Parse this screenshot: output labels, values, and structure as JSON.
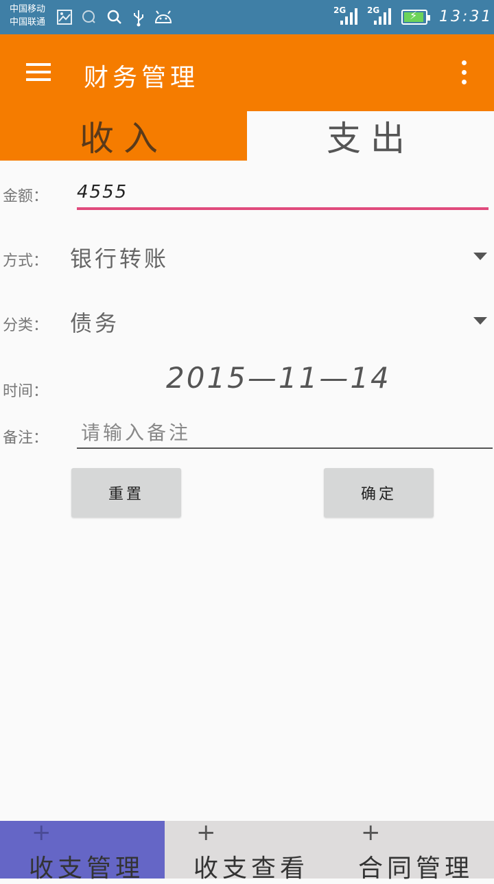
{
  "status_bar": {
    "carrier_1": "中国移动",
    "carrier_2": "中国联通",
    "signal_1_label": "2G",
    "signal_2_label": "2G",
    "time": "13:31",
    "icons": [
      "image-icon",
      "search-circle-icon",
      "search-icon",
      "usb-icon",
      "android-icon",
      "battery-charging-icon"
    ]
  },
  "app_bar": {
    "title": "财务管理",
    "color": "#f57c00"
  },
  "tabs": {
    "income": "收入",
    "expense": "支出",
    "selected": "支出"
  },
  "form": {
    "amount_label": "金额：",
    "amount_value": "4555",
    "method_label": "方式：",
    "method_value": "银行转账",
    "category_label": "分类：",
    "category_value": "债务",
    "date_label": "时间：",
    "date_value": "2015—11—14",
    "note_label": "备注：",
    "note_placeholder": "请输入备注",
    "reset_button": "重置",
    "confirm_button": "确定"
  },
  "bottom_nav": {
    "items": [
      {
        "label": "收支管理",
        "icon": "+"
      },
      {
        "label": "收支查看",
        "icon": "+"
      },
      {
        "label": "合同管理",
        "icon": "+"
      }
    ],
    "active": "收支管理",
    "active_color": "#6566c6"
  }
}
